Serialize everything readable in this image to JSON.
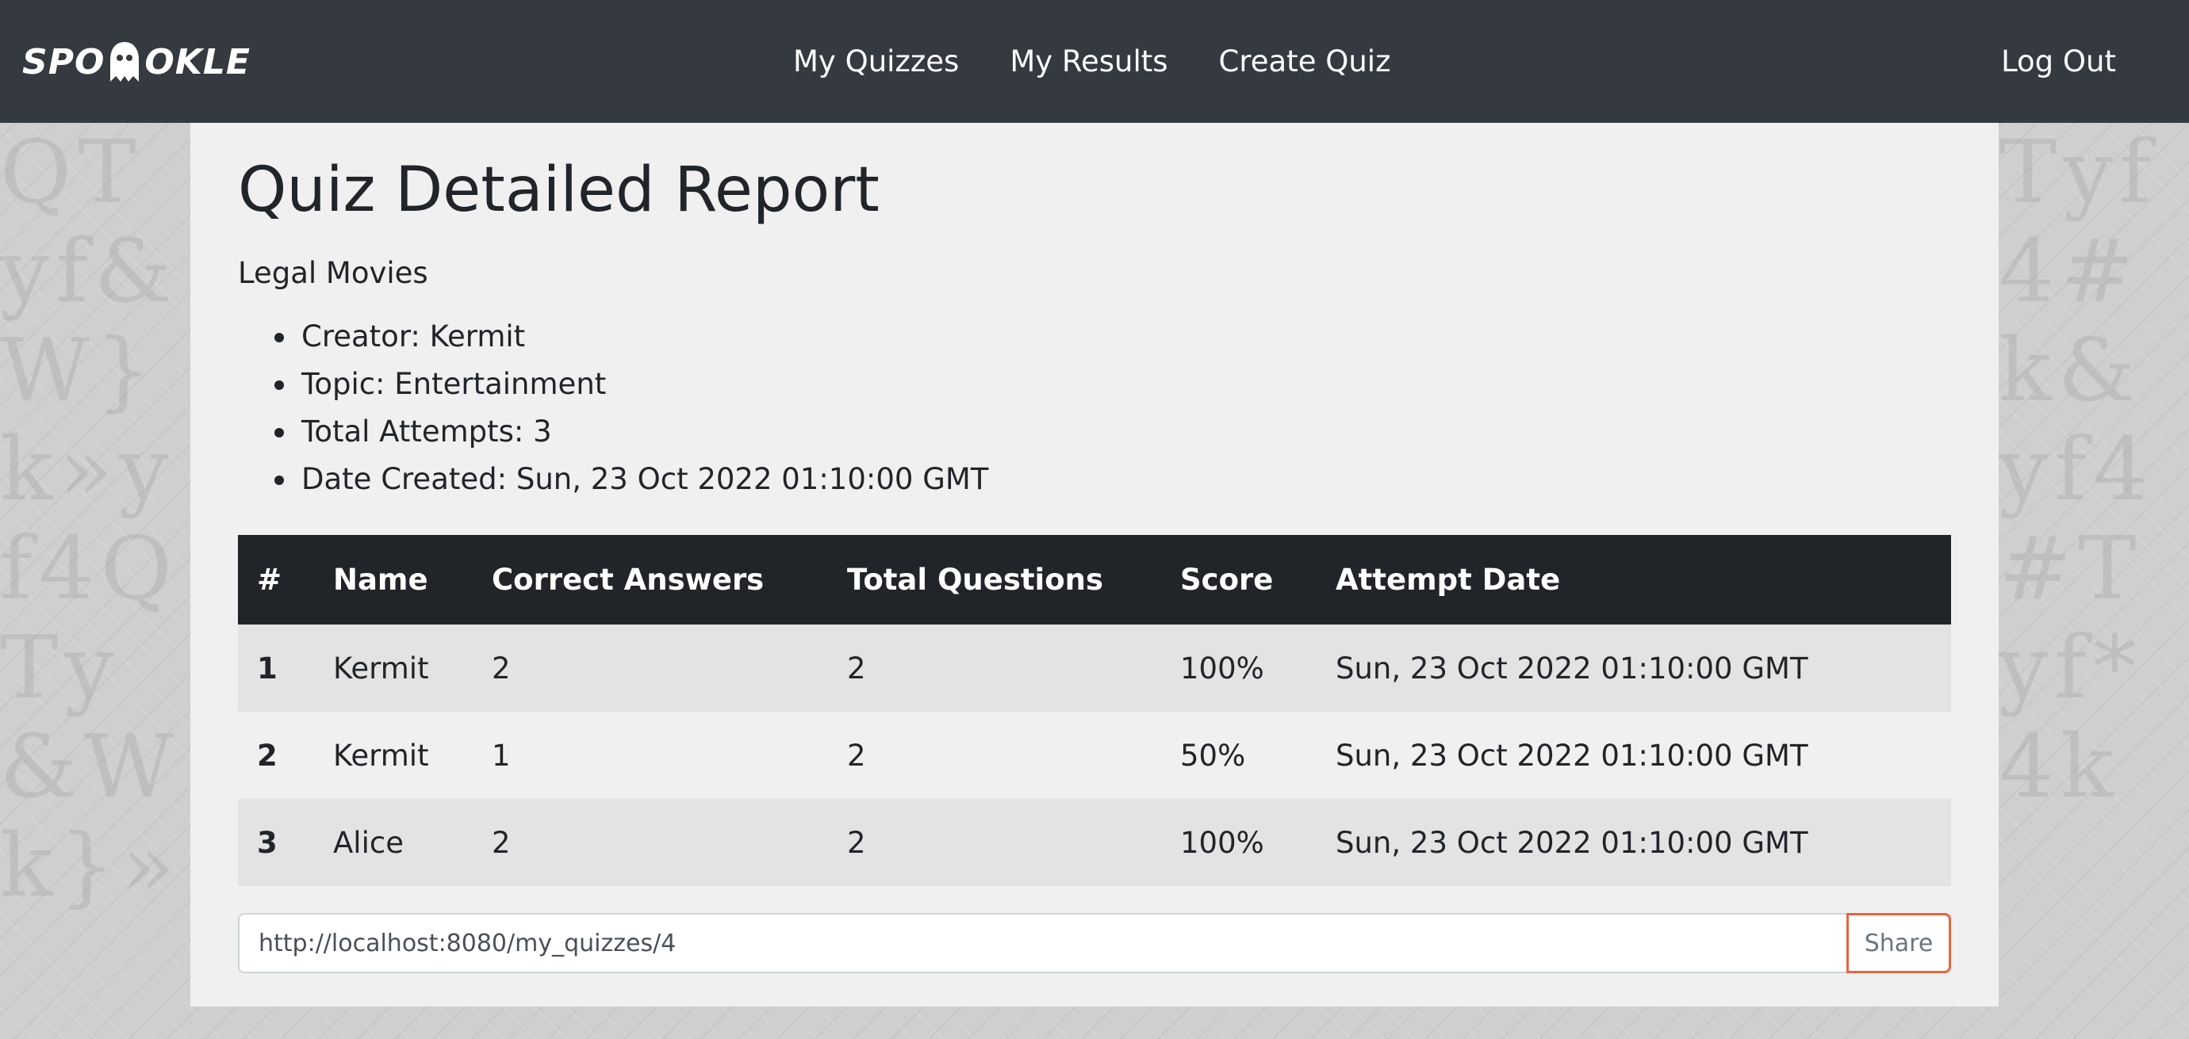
{
  "brand": {
    "logo_left": "SPO",
    "logo_right": "OKLE"
  },
  "nav": {
    "links": [
      "My Quizzes",
      "My Results",
      "Create Quiz"
    ],
    "logout": "Log Out"
  },
  "report": {
    "title": "Quiz Detailed Report",
    "quiz_name": "Legal Movies",
    "meta": [
      "Creator: Kermit",
      "Topic: Entertainment",
      "Total Attempts: 3",
      "Date Created: Sun, 23 Oct 2022 01:10:00 GMT"
    ]
  },
  "table": {
    "headers": [
      "#",
      "Name",
      "Correct Answers",
      "Total Questions",
      "Score",
      "Attempt Date"
    ],
    "rows": [
      [
        "1",
        "Kermit",
        "2",
        "2",
        "100%",
        "Sun, 23 Oct 2022 01:10:00 GMT"
      ],
      [
        "2",
        "Kermit",
        "1",
        "2",
        "50%",
        "Sun, 23 Oct 2022 01:10:00 GMT"
      ],
      [
        "3",
        "Alice",
        "2",
        "2",
        "100%",
        "Sun, 23 Oct 2022 01:10:00 GMT"
      ]
    ]
  },
  "share": {
    "url": "http://localhost:8080/my_quizzes/4",
    "button": "Share"
  },
  "colors": {
    "navbar": "#343a40",
    "table_header": "#212529",
    "card": "#f0f0f0",
    "share_border": "#e8643c"
  }
}
